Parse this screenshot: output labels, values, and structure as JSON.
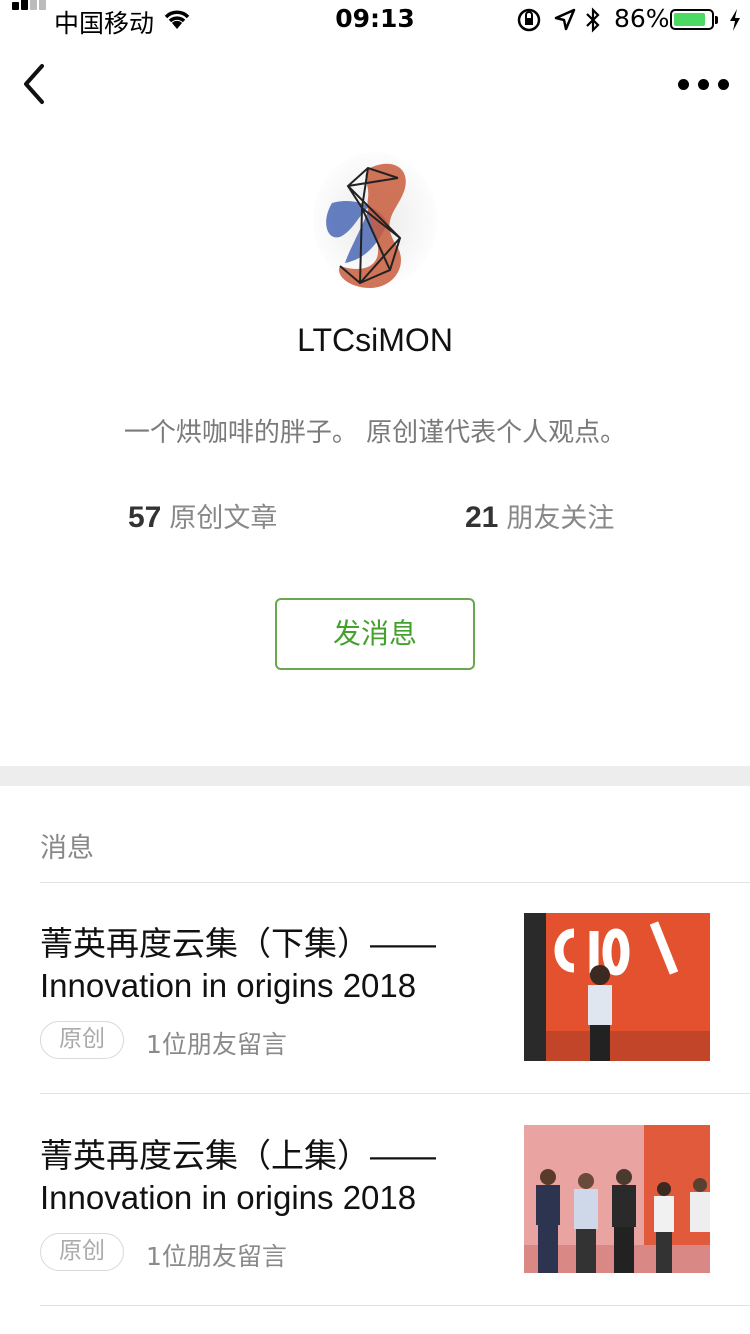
{
  "status_bar": {
    "carrier": "中国移动",
    "time": "09:13",
    "battery_percent": "86%",
    "battery_level": 0.86
  },
  "nav": {
    "back_icon": "chevron-left-icon",
    "more_icon": "ellipsis-icon"
  },
  "profile": {
    "name": "LTCsiMON",
    "bio": "一个烘咖啡的胖子。 原创谨代表个人观点。",
    "stats": [
      {
        "number": "57",
        "label": "原创文章"
      },
      {
        "number": "21",
        "label": "朋友关注"
      }
    ],
    "message_button": "发消息"
  },
  "section_label": "消息",
  "articles": [
    {
      "title": "菁英再度云集（下集）——Innovation in origins 2018",
      "tag": "原创",
      "comments": "1位朋友留言"
    },
    {
      "title": "菁英再度云集（上集）——Innovation in origins 2018",
      "tag": "原创",
      "comments": "1位朋友留言"
    }
  ],
  "colors": {
    "accent_green": "#45a12d",
    "button_border": "#6aa84f",
    "divider": "#ededed"
  }
}
